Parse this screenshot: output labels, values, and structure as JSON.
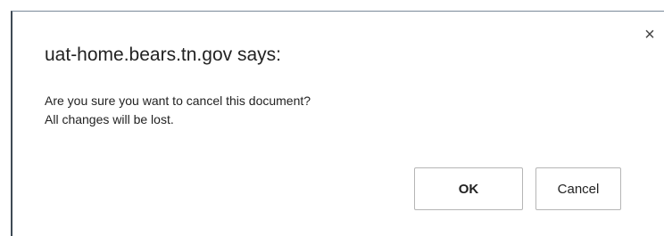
{
  "dialog": {
    "title": "uat-home.bears.tn.gov says:",
    "close_glyph": "×",
    "close_icon": "close-icon",
    "message_lines": [
      "Are you sure you want to cancel this document?",
      "All changes will be lost."
    ],
    "ok_label": "OK",
    "cancel_label": "Cancel"
  }
}
